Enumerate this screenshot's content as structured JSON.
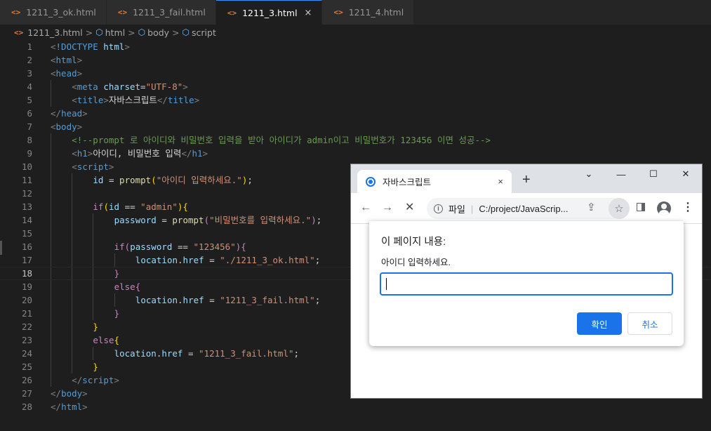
{
  "editor": {
    "tabs": [
      {
        "icon": "<>",
        "label": "1211_3_ok.html",
        "active": false
      },
      {
        "icon": "<>",
        "label": "1211_3_fail.html",
        "active": false
      },
      {
        "icon": "<>",
        "label": "1211_3.html",
        "active": true,
        "close": "×"
      },
      {
        "icon": "<>",
        "label": "1211_4.html",
        "active": false
      }
    ],
    "breadcrumb": {
      "file": "1211_3.html",
      "items": [
        "html",
        "body",
        "script"
      ],
      "separator": ">"
    },
    "current_line": 18,
    "lines": [
      {
        "n": "1",
        "indent": 0,
        "html": "<span class='br'>&lt;</span><span class='tg'>!DOCTYPE</span> <span class='at'>html</span><span class='br'>&gt;</span>"
      },
      {
        "n": "2",
        "indent": 0,
        "html": "<span class='br'>&lt;</span><span class='tg'>html</span><span class='br'>&gt;</span>"
      },
      {
        "n": "3",
        "indent": 0,
        "html": "<span class='br'>&lt;</span><span class='tg'>head</span><span class='br'>&gt;</span>"
      },
      {
        "n": "4",
        "indent": 1,
        "html": "<span class='br'>&lt;</span><span class='tg'>meta</span> <span class='at'>charset</span><span class='pt'>=</span><span class='st'>\"UTF-8\"</span><span class='br'>&gt;</span>"
      },
      {
        "n": "5",
        "indent": 1,
        "html": "<span class='br'>&lt;</span><span class='tg'>title</span><span class='br'>&gt;</span><span class='wt'>자바스크립트</span><span class='br'>&lt;/</span><span class='tg'>title</span><span class='br'>&gt;</span>"
      },
      {
        "n": "6",
        "indent": 0,
        "html": "<span class='br'>&lt;/</span><span class='tg'>head</span><span class='br'>&gt;</span>"
      },
      {
        "n": "7",
        "indent": 0,
        "html": "<span class='br'>&lt;</span><span class='tg'>body</span><span class='br'>&gt;</span>"
      },
      {
        "n": "8",
        "indent": 1,
        "html": "<span class='cm'>&lt;!--prompt 로 아이디와 비밀번호 입력을 받아 아이디가 admin이고 비밀번호가 123456 이면 성공--&gt;</span>"
      },
      {
        "n": "9",
        "indent": 1,
        "html": "<span class='br'>&lt;</span><span class='tg'>h1</span><span class='br'>&gt;</span><span class='wt'>아이디, 비밀번호 입력</span><span class='br'>&lt;/</span><span class='tg'>h1</span><span class='br'>&gt;</span>"
      },
      {
        "n": "10",
        "indent": 1,
        "html": "<span class='br'>&lt;</span><span class='tg'>script</span><span class='br'>&gt;</span>"
      },
      {
        "n": "11",
        "indent": 2,
        "html": "<span class='vr'>id</span> <span class='pt'>=</span> <span class='fn'>prompt</span><span class='by'>(</span><span class='st'>\"아이디 입력하세요.\"</span><span class='by'>)</span><span class='pt'>;</span>"
      },
      {
        "n": "12",
        "indent": 2,
        "html": ""
      },
      {
        "n": "13",
        "indent": 2,
        "html": "<span class='kw'>if</span><span class='by'>(</span><span class='vr'>id</span> <span class='pt'>==</span> <span class='st'>\"admin\"</span><span class='by'>){</span>"
      },
      {
        "n": "14",
        "indent": 3,
        "html": "<span class='vr'>password</span> <span class='pt'>=</span> <span class='fn'>prompt</span><span class='kw'>(</span><span class='st'>\"비밀번호를 입력하세요.\"</span><span class='kw'>)</span><span class='pt'>;</span>"
      },
      {
        "n": "15",
        "indent": 3,
        "html": ""
      },
      {
        "n": "16",
        "indent": 3,
        "html": "<span class='kw'>if</span><span class='kw'>(</span><span class='vr'>password</span> <span class='pt'>==</span> <span class='st'>\"123456\"</span><span class='kw'>){</span>"
      },
      {
        "n": "17",
        "indent": 4,
        "html": "<span class='vr'>location</span><span class='pt'>.</span><span class='vr'>href</span> <span class='pt'>=</span> <span class='st'>\"./1211_3_ok.html\"</span><span class='pt'>;</span>"
      },
      {
        "n": "18",
        "indent": 3,
        "html": "<span class='kw'>}</span>"
      },
      {
        "n": "19",
        "indent": 3,
        "html": "<span class='kw'>else</span><span class='kw'>{</span>"
      },
      {
        "n": "20",
        "indent": 4,
        "html": "<span class='vr'>location</span><span class='pt'>.</span><span class='vr'>href</span> <span class='pt'>=</span> <span class='st'>\"1211_3_fail.html\"</span><span class='pt'>;</span>"
      },
      {
        "n": "21",
        "indent": 3,
        "html": "<span class='kw'>}</span>"
      },
      {
        "n": "22",
        "indent": 2,
        "html": "<span class='by'>}</span>"
      },
      {
        "n": "23",
        "indent": 2,
        "html": "<span class='kw'>else</span><span class='by'>{</span>"
      },
      {
        "n": "24",
        "indent": 3,
        "html": "<span class='vr'>location</span><span class='pt'>.</span><span class='vr'>href</span> <span class='pt'>=</span> <span class='st'>\"1211_3_fail.html\"</span><span class='pt'>;</span>"
      },
      {
        "n": "25",
        "indent": 2,
        "html": "<span class='by'>}</span>"
      },
      {
        "n": "26",
        "indent": 1,
        "html": "<span class='br'>&lt;/</span><span class='tg'>script</span><span class='br'>&gt;</span>"
      },
      {
        "n": "27",
        "indent": 0,
        "html": "<span class='br'>&lt;/</span><span class='tg'>body</span><span class='br'>&gt;</span>"
      },
      {
        "n": "28",
        "indent": 0,
        "html": "<span class='br'>&lt;/</span><span class='tg'>html</span><span class='br'>&gt;</span>"
      }
    ]
  },
  "browser": {
    "tab_title": "자바스크립트",
    "tab_close": "×",
    "new_tab": "+",
    "window_controls": {
      "minimize": "—",
      "maximize": "☐",
      "close": "✕",
      "tab_search": "⌄"
    },
    "nav": {
      "back": "←",
      "forward": "→",
      "stop": "✕"
    },
    "omnibox": {
      "scheme_label": "파일",
      "url": "C:/project/JavaScrip..."
    },
    "toolbar_icons": {
      "share": "⇪",
      "star": "☆",
      "menu": "⋮"
    },
    "dialog": {
      "title": "이 페이지 내용:",
      "message": "아이디 입력하세요.",
      "input_value": "",
      "ok_label": "확인",
      "cancel_label": "취소"
    }
  },
  "colors": {
    "editor_bg": "#1e1e1e",
    "tag": "#569cd6",
    "string": "#ce9178",
    "comment": "#6a9955",
    "keyword": "#c586c0",
    "function": "#dcdcaa",
    "variable": "#9cdcfe",
    "accent_blue": "#1a73e8",
    "file_icon": "#e37933"
  }
}
